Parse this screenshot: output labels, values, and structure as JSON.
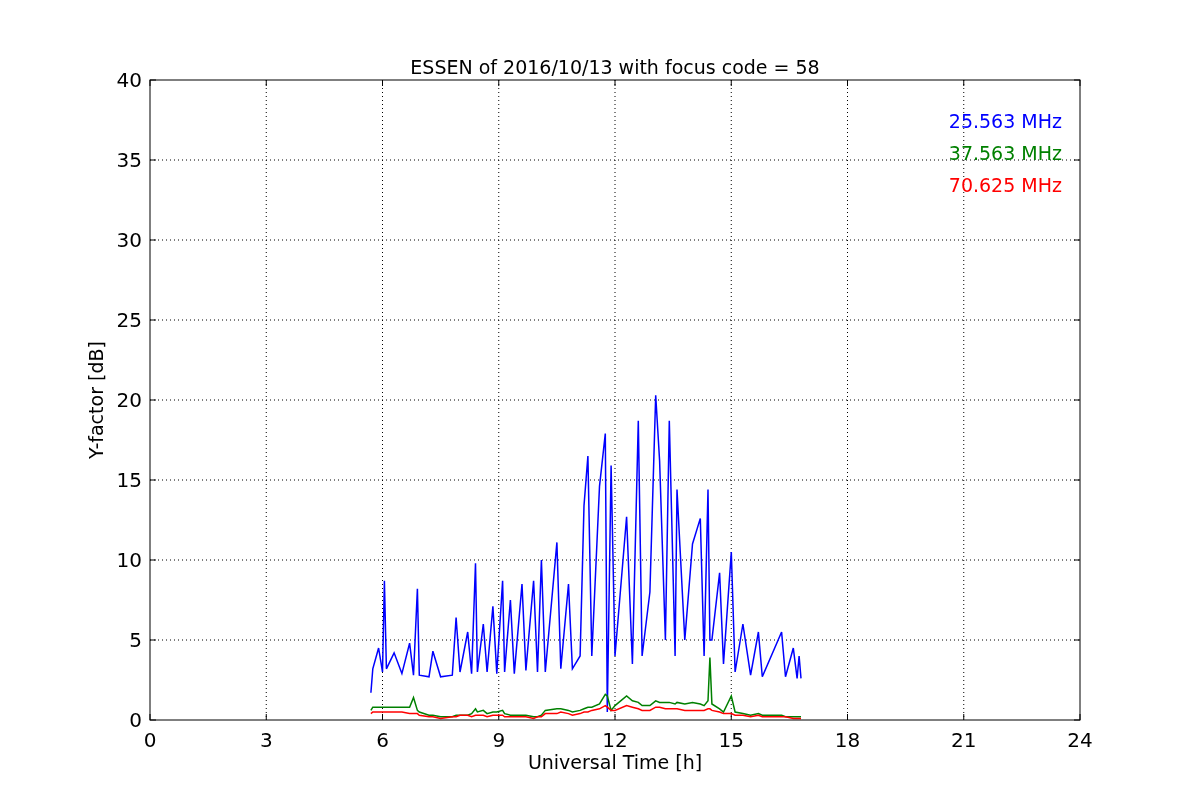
{
  "figure": {
    "chart_data": {
      "type": "line",
      "title": "ESSEN of 2016/10/13 with focus code = 58",
      "xlabel": "Universal Time [h]",
      "ylabel": "Y-factor [dB]",
      "x": [
        5.7,
        5.75,
        5.9,
        6.0,
        6.05,
        6.1,
        6.3,
        6.5,
        6.7,
        6.8,
        6.9,
        6.95,
        7.2,
        7.3,
        7.5,
        7.8,
        7.9,
        8.0,
        8.2,
        8.3,
        8.4,
        8.45,
        8.6,
        8.7,
        8.85,
        8.95,
        9.1,
        9.15,
        9.3,
        9.4,
        9.6,
        9.7,
        9.9,
        10.0,
        10.1,
        10.2,
        10.5,
        10.6,
        10.8,
        10.9,
        11.1,
        11.2,
        11.3,
        11.4,
        11.6,
        11.75,
        11.8,
        11.9,
        12.0,
        12.3,
        12.45,
        12.6,
        12.7,
        12.9,
        13.05,
        13.15,
        13.3,
        13.4,
        13.55,
        13.6,
        13.8,
        14.0,
        14.2,
        14.3,
        14.4,
        14.45,
        14.5,
        14.7,
        14.8,
        15.0,
        15.1,
        15.3,
        15.5,
        15.7,
        15.8,
        16.3,
        16.4,
        16.6,
        16.7,
        16.75,
        16.8
      ],
      "series": [
        {
          "name": "25.563 MHz",
          "color": "#0000ff",
          "values": [
            1.7,
            3.2,
            4.5,
            3.0,
            8.7,
            3.2,
            4.2,
            2.9,
            4.8,
            2.8,
            8.2,
            2.8,
            2.7,
            4.3,
            2.7,
            2.8,
            6.4,
            3.0,
            5.5,
            2.9,
            9.8,
            3.0,
            6.0,
            3.0,
            7.1,
            2.9,
            8.7,
            3.0,
            7.5,
            2.9,
            8.5,
            3.1,
            8.7,
            3.0,
            10.0,
            3.0,
            11.1,
            3.2,
            8.5,
            3.2,
            4.0,
            13.4,
            16.5,
            4.0,
            14.6,
            17.9,
            0.5,
            15.9,
            4.0,
            12.7,
            3.5,
            18.7,
            4.0,
            8.0,
            20.3,
            16.2,
            5.0,
            18.7,
            4.0,
            14.4,
            5.0,
            11.0,
            12.6,
            4.0,
            14.4,
            5.0,
            5.0,
            9.2,
            3.5,
            10.5,
            3.0,
            6.0,
            2.8,
            5.5,
            2.7,
            5.5,
            2.7,
            4.5,
            2.6,
            4.0,
            2.6
          ]
        },
        {
          "name": "37.563 MHz",
          "color": "#008000",
          "values": [
            0.6,
            0.8,
            0.8,
            0.8,
            0.8,
            0.8,
            0.8,
            0.8,
            0.8,
            1.4,
            0.6,
            0.5,
            0.3,
            0.3,
            0.2,
            0.2,
            0.3,
            0.3,
            0.3,
            0.4,
            0.7,
            0.5,
            0.6,
            0.4,
            0.5,
            0.5,
            0.6,
            0.4,
            0.3,
            0.3,
            0.3,
            0.3,
            0.2,
            0.2,
            0.3,
            0.6,
            0.7,
            0.7,
            0.6,
            0.5,
            0.6,
            0.7,
            0.8,
            0.8,
            1.0,
            1.6,
            1.5,
            0.6,
            0.9,
            1.5,
            1.2,
            1.1,
            0.9,
            0.9,
            1.2,
            1.1,
            1.1,
            1.1,
            1.0,
            1.1,
            1.0,
            1.1,
            1.0,
            0.9,
            1.2,
            3.9,
            1.0,
            0.7,
            0.5,
            1.5,
            0.5,
            0.4,
            0.3,
            0.4,
            0.3,
            0.3,
            0.2,
            0.2,
            0.2,
            0.2,
            0.2
          ]
        },
        {
          "name": "70.625 MHz",
          "color": "#ff0000",
          "values": [
            0.4,
            0.5,
            0.5,
            0.5,
            0.5,
            0.5,
            0.5,
            0.5,
            0.4,
            0.4,
            0.4,
            0.3,
            0.2,
            0.2,
            0.1,
            0.2,
            0.2,
            0.3,
            0.3,
            0.2,
            0.3,
            0.3,
            0.3,
            0.2,
            0.3,
            0.3,
            0.3,
            0.2,
            0.2,
            0.2,
            0.2,
            0.2,
            0.1,
            0.2,
            0.2,
            0.4,
            0.4,
            0.5,
            0.4,
            0.3,
            0.4,
            0.5,
            0.5,
            0.6,
            0.7,
            0.9,
            0.8,
            0.6,
            0.6,
            0.9,
            0.8,
            0.7,
            0.6,
            0.6,
            0.8,
            0.8,
            0.7,
            0.7,
            0.7,
            0.7,
            0.6,
            0.6,
            0.6,
            0.6,
            0.7,
            0.7,
            0.6,
            0.5,
            0.4,
            0.4,
            0.3,
            0.3,
            0.2,
            0.3,
            0.2,
            0.2,
            0.2,
            0.1,
            0.1,
            0.1,
            0.1
          ]
        }
      ],
      "grid": true,
      "xlim": [
        0,
        24
      ],
      "ylim": [
        0,
        40
      ],
      "xticks": [
        0,
        3,
        6,
        9,
        12,
        15,
        18,
        21,
        24
      ],
      "yticks": [
        0,
        5,
        10,
        15,
        20,
        25,
        30,
        35,
        40
      ]
    }
  }
}
